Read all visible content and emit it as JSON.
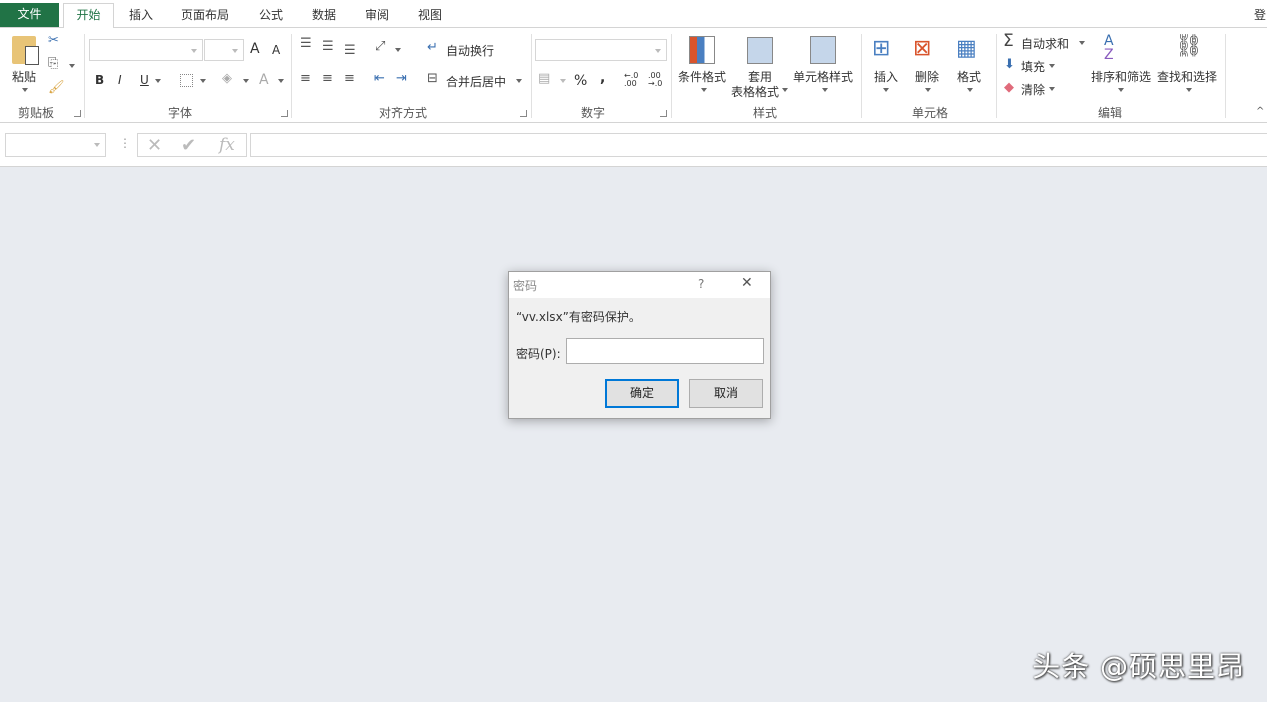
{
  "tabs": [
    {
      "label": "文件"
    },
    {
      "label": "开始"
    },
    {
      "label": "插入"
    },
    {
      "label": "页面布局"
    },
    {
      "label": "公式"
    },
    {
      "label": "数据"
    },
    {
      "label": "审阅"
    },
    {
      "label": "视图"
    }
  ],
  "signin": "登",
  "ribbon": {
    "clipboard": {
      "paste": "粘贴",
      "group": "剪贴板"
    },
    "font": {
      "bold": "B",
      "italic": "I",
      "underline": "U",
      "grow": "A",
      "shrink": "A",
      "fontcolor": "A",
      "group": "字体"
    },
    "alignment": {
      "wrap": "自动换行",
      "merge": "合并后居中",
      "group": "对齐方式"
    },
    "number": {
      "percent": "%",
      "comma": ",",
      "inc": "←.0 .00",
      "dec": ".00 →.0",
      "group": "数字"
    },
    "styles": {
      "conditional": "条件格式",
      "table1": "套用",
      "table2": "表格格式",
      "cell": "单元格样式",
      "group": "样式"
    },
    "cells": {
      "insert": "插入",
      "delete": "删除",
      "format": "格式",
      "group": "单元格"
    },
    "editing": {
      "autosum": "自动求和",
      "fill": "填充",
      "clear": "清除",
      "sort": "排序和筛选",
      "find": "查找和选择",
      "group": "编辑"
    }
  },
  "formula_bar": {
    "name_box": "",
    "cancel": "✕",
    "enter": "✔",
    "fx": "fx",
    "value": ""
  },
  "dialog": {
    "title": "密码",
    "help": "?",
    "close": "✕",
    "message": "“vv.xlsx”有密码保护。",
    "password_label": "密码(P):",
    "password_value": "",
    "ok": "确定",
    "cancel": "取消"
  },
  "watermark": "头条 @硕思里昂",
  "colors": {
    "file_tab": "#217346",
    "accent": "#0078d7",
    "workspace": "#e8ebf0"
  }
}
